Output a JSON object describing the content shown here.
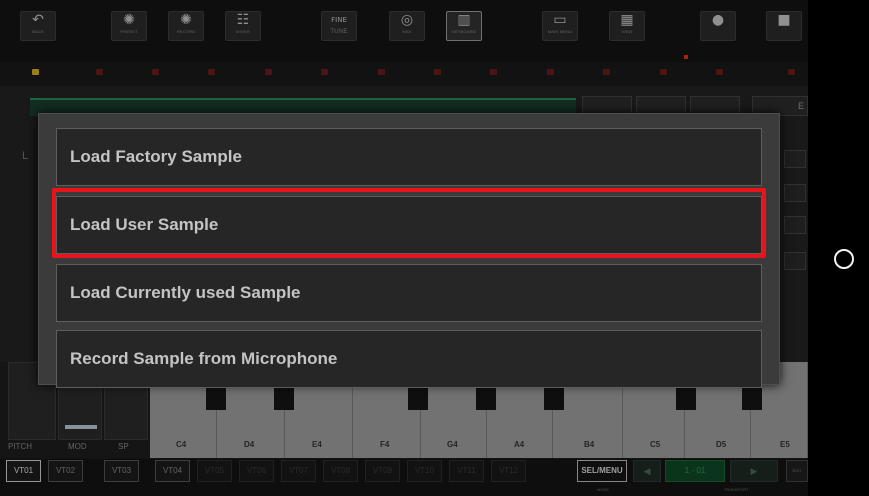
{
  "toolbar": {
    "buttons": [
      {
        "icon": "undo-icon",
        "glyph": "↶",
        "label": "BACK"
      },
      {
        "icon": "preset-icon",
        "glyph": "✺",
        "label": "PRESET"
      },
      {
        "icon": "record-icon",
        "glyph": "✺",
        "label": "RECORD"
      },
      {
        "icon": "mixer-icon",
        "glyph": "☷",
        "label": "MIXER"
      },
      {
        "icon": "fine-tune-icon",
        "glyph": "FINE",
        "label": "TUNE"
      },
      {
        "icon": "midi-icon",
        "glyph": "◎",
        "label": "MIDI"
      },
      {
        "icon": "keyboard-icon",
        "glyph": "▥",
        "label": "KEYBOARD"
      },
      {
        "icon": "main-menu-icon",
        "glyph": "▭",
        "label": "MAIN MENU"
      },
      {
        "icon": "view-icon",
        "glyph": "▦",
        "label": "VIEW"
      },
      {
        "icon": "record-dot-icon",
        "glyph": "●",
        "label": ""
      },
      {
        "icon": "stop-icon",
        "glyph": "■",
        "label": ""
      }
    ]
  },
  "top_right_label": "E",
  "menu": {
    "items": [
      {
        "label": "Load Factory Sample"
      },
      {
        "label": "Load User Sample"
      },
      {
        "label": "Load Currently used Sample"
      },
      {
        "label": "Record Sample from Microphone"
      }
    ],
    "highlighted_index": 1,
    "highlight_color": "#e8141a"
  },
  "keyboard": {
    "notes": [
      "C4",
      "D4",
      "E4",
      "F4",
      "G4",
      "A4",
      "B4",
      "C5",
      "D5",
      "E5"
    ]
  },
  "pads": {
    "labels": [
      "PITCH",
      "MOD",
      "SP"
    ]
  },
  "voices": {
    "tracks": [
      "VT01",
      "VT02",
      "VT03",
      "VT04",
      "VT05",
      "VT06",
      "VT07",
      "VT08",
      "VT09",
      "VT10",
      "VT11",
      "VT12"
    ],
    "selected": "VT01",
    "sel_menu_label": "SEL/MENU",
    "display_value": "1 - 01",
    "right_label": "EDIT",
    "mode_label": "MODE",
    "transport_label": "TRANSPORT"
  },
  "colors": {
    "accent_green": "#2d8a5e",
    "highlight_red": "#e8141a"
  }
}
